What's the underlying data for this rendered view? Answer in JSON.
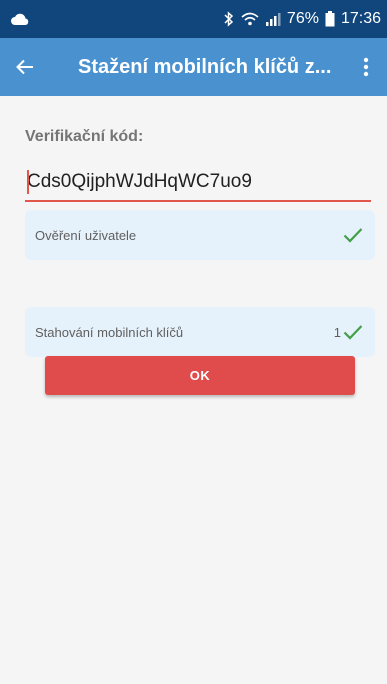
{
  "status_bar": {
    "left_icons": [
      "cloud-icon"
    ],
    "right_icons": [
      "bluetooth-icon",
      "wifi-icon",
      "signal-icon",
      "battery-icon"
    ],
    "battery_percent": "76%",
    "time": "17:36"
  },
  "app_bar": {
    "title": "Stažení mobilních klíčů z...",
    "back_icon": "arrow-left-icon",
    "menu_icon": "more-vert-icon"
  },
  "form": {
    "label": "Verifikační kód:",
    "code_value": "Cds0QijphWJdHqWC7uo9"
  },
  "steps": [
    {
      "label": "Ověření uživatele",
      "count": "",
      "status_icon": "check-icon"
    },
    {
      "label": "Stahování mobilních klíčů",
      "count": "1",
      "status_icon": "check-icon"
    }
  ],
  "ok_button": {
    "label": "OK"
  },
  "colors": {
    "status_bar": "#10467c",
    "app_bar": "#4a91d0",
    "accent_red": "#e04b4b",
    "input_underline": "#e2564c",
    "card_bg": "#e6f2fb",
    "check_green": "#43a047"
  }
}
